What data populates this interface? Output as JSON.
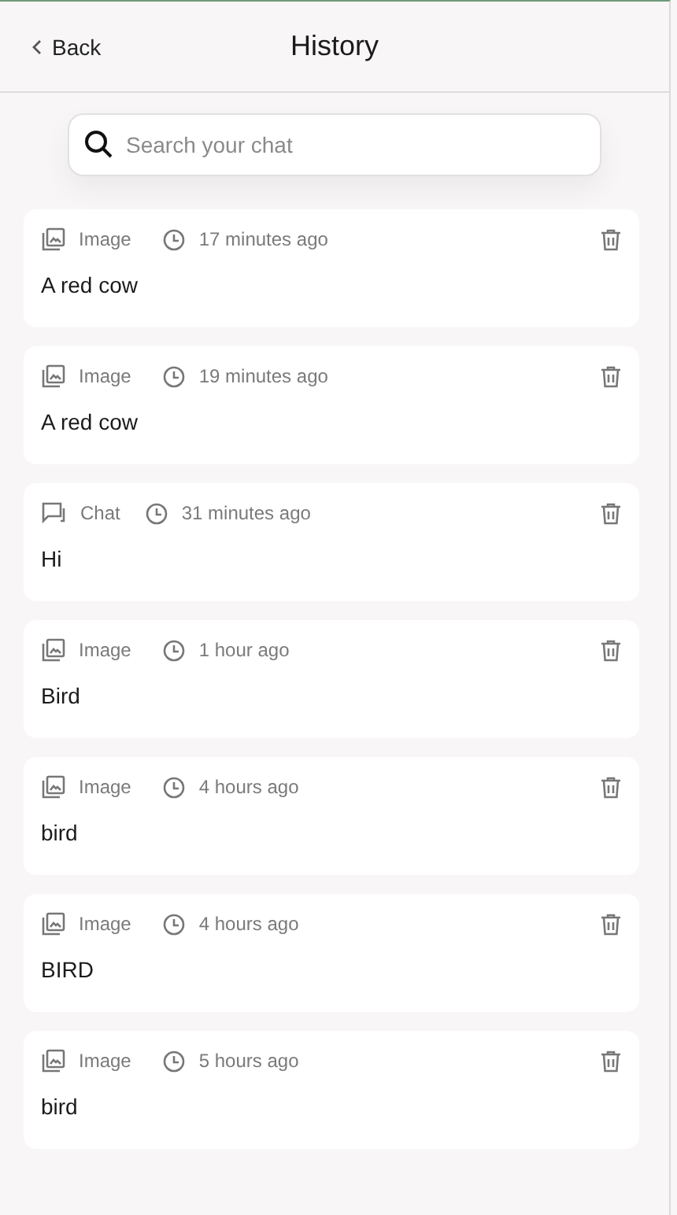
{
  "header": {
    "back": "Back",
    "title": "History"
  },
  "search": {
    "placeholder": "Search your chat"
  },
  "items": [
    {
      "kind": "image",
      "type_label": "Image",
      "time": "17 minutes ago",
      "text": "A red cow"
    },
    {
      "kind": "image",
      "type_label": "Image",
      "time": "19 minutes ago",
      "text": "A red cow"
    },
    {
      "kind": "chat",
      "type_label": "Chat",
      "time": "31 minutes ago",
      "text": "Hi"
    },
    {
      "kind": "image",
      "type_label": "Image",
      "time": "1 hour ago",
      "text": "Bird"
    },
    {
      "kind": "image",
      "type_label": "Image",
      "time": "4 hours ago",
      "text": "bird"
    },
    {
      "kind": "image",
      "type_label": "Image",
      "time": "4 hours ago",
      "text": "BIRD"
    },
    {
      "kind": "image",
      "type_label": "Image",
      "time": "5 hours ago",
      "text": "bird"
    }
  ]
}
